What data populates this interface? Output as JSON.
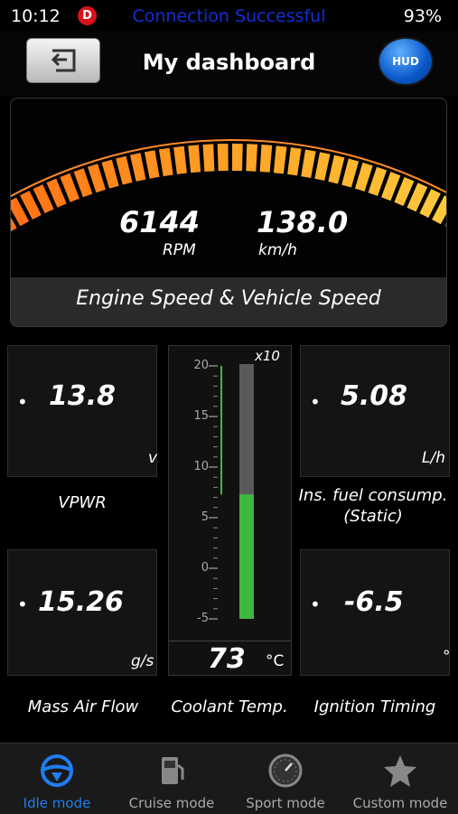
{
  "status_bar": {
    "time": "10:12",
    "badge": "D",
    "message": "Connection Successful",
    "battery": "93%"
  },
  "header": {
    "title": "My dashboard",
    "hud_label": "HUD"
  },
  "main_gauge": {
    "rpm_value": "6144",
    "rpm_unit": "RPM",
    "speed_value": "138.0",
    "speed_unit": "km/h",
    "label": "Engine Speed & Vehicle Speed",
    "level": 0.73
  },
  "tiles": {
    "vpwr": {
      "value": "13.8",
      "unit": "v",
      "label": "VPWR"
    },
    "fuel": {
      "value": "5.08",
      "unit": "L/h",
      "label_line1": "Ins. fuel consump.",
      "label_line2": "(Static)"
    },
    "maf": {
      "value": "15.26",
      "unit": "g/s",
      "label": "Mass Air Flow"
    },
    "ignition": {
      "value": "-6.5",
      "unit": "°",
      "label": "Ignition Timing"
    }
  },
  "coolant": {
    "multiplier": "x10",
    "ticks": [
      "20",
      "15",
      "10",
      "5",
      "0",
      "-5"
    ],
    "value": "73",
    "unit": "°C",
    "label": "Coolant Temp.",
    "level_x10": 7.3
  },
  "tabbar": {
    "tabs": [
      {
        "label": "Idle mode",
        "icon": "steering-wheel-icon",
        "active": true
      },
      {
        "label": "Cruise mode",
        "icon": "fuel-pump-icon",
        "active": false
      },
      {
        "label": "Sport mode",
        "icon": "speedometer-icon",
        "active": false
      },
      {
        "label": "Custom mode",
        "icon": "star-icon",
        "active": false
      }
    ]
  },
  "colors": {
    "accent": "#1f7ef0",
    "status_message": "#1030d8",
    "bar_green": "#3fb83f",
    "badge_red": "#d8111b"
  }
}
